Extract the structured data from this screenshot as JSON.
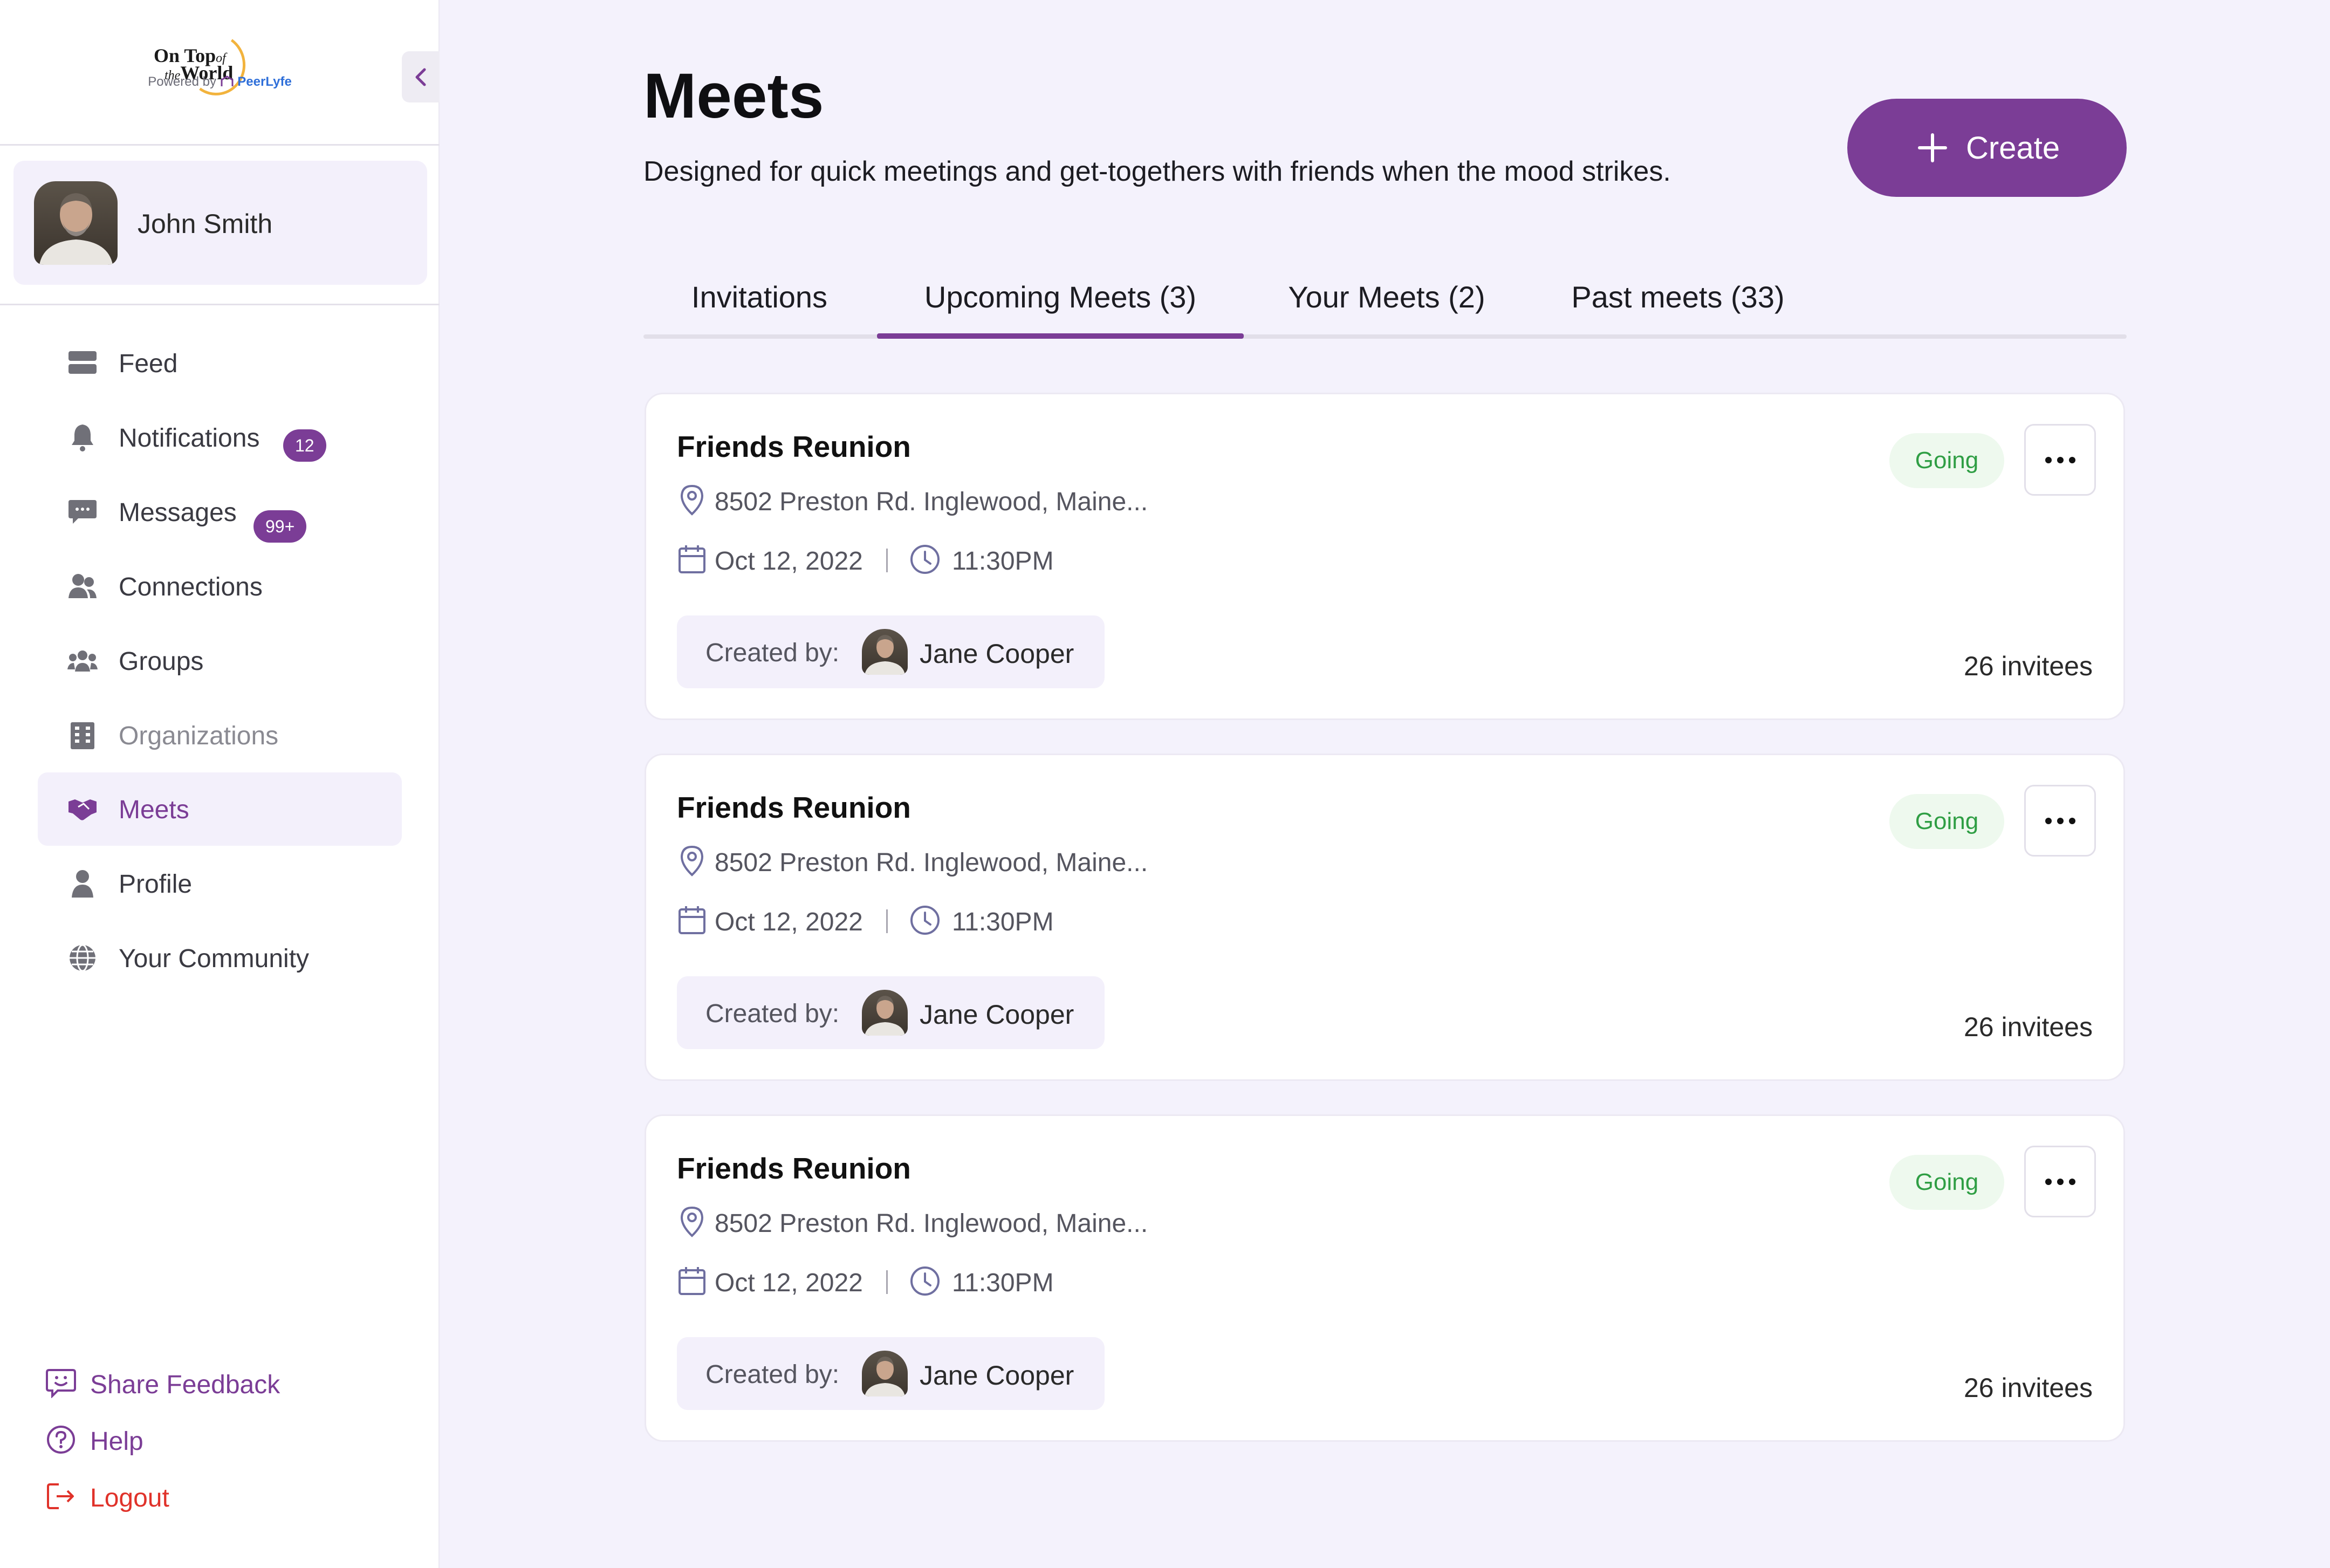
{
  "brand": {
    "logo_line1": "On Top",
    "logo_line1_small": "of",
    "logo_line2_small": "the",
    "logo_line2": "World",
    "powered_by": "Powered by",
    "powered_brand": "PeerLyfe"
  },
  "user": {
    "name": "John Smith"
  },
  "nav": [
    {
      "label": "Feed",
      "icon": "feed-icon"
    },
    {
      "label": "Notifications",
      "icon": "bell-icon",
      "badge": "12"
    },
    {
      "label": "Messages",
      "icon": "chat-icon",
      "badge": "99+"
    },
    {
      "label": "Connections",
      "icon": "people-icon"
    },
    {
      "label": "Groups",
      "icon": "group-icon"
    },
    {
      "label": "Organizations",
      "icon": "building-icon"
    },
    {
      "label": "Meets",
      "icon": "handshake-icon",
      "active": true
    },
    {
      "label": "Profile",
      "icon": "person-icon"
    },
    {
      "label": "Your Community",
      "icon": "globe-icon"
    }
  ],
  "footer_links": [
    {
      "label": "Share Feedback",
      "icon": "feedback-icon",
      "color": "#7b3d96"
    },
    {
      "label": "Help",
      "icon": "help-icon",
      "color": "#7b3d96"
    },
    {
      "label": "Logout",
      "icon": "logout-icon",
      "color": "#e0322a"
    }
  ],
  "page": {
    "title": "Meets",
    "subtitle": "Designed for quick meetings and get-togethers with friends when the mood strikes.",
    "create_label": "Create"
  },
  "tabs": [
    {
      "label": "Invitations"
    },
    {
      "label": "Upcoming Meets (3)",
      "active": true
    },
    {
      "label": "Your Meets (2)"
    },
    {
      "label": "Past meets (33)"
    }
  ],
  "meets": [
    {
      "title": "Friends Reunion",
      "location": "8502 Preston Rd. Inglewood, Maine...",
      "date": "Oct 12, 2022",
      "time": "11:30PM",
      "created_by_label": "Created by:",
      "creator": "Jane Cooper",
      "status": "Going",
      "invitees": "26 invitees"
    },
    {
      "title": "Friends Reunion",
      "location": "8502 Preston Rd. Inglewood, Maine...",
      "date": "Oct 12, 2022",
      "time": "11:30PM",
      "created_by_label": "Created by:",
      "creator": "Jane Cooper",
      "status": "Going",
      "invitees": "26 invitees"
    },
    {
      "title": "Friends Reunion",
      "location": "8502 Preston Rd. Inglewood, Maine...",
      "date": "Oct 12, 2022",
      "time": "11:30PM",
      "created_by_label": "Created by:",
      "creator": "Jane Cooper",
      "status": "Going",
      "invitees": "26 invitees"
    }
  ],
  "colors": {
    "accent": "#7b3d96",
    "background": "#f4f2fc",
    "going_text": "#2f9e44",
    "going_bg": "#eef9ee",
    "logout": "#e0322a"
  }
}
